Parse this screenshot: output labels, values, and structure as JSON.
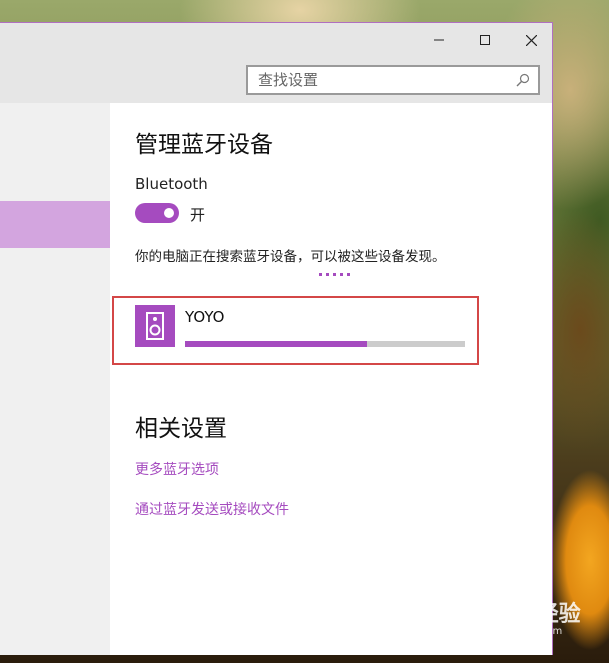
{
  "window": {
    "controls": {
      "minimize": "minimize-icon",
      "maximize": "maximize-icon",
      "close": "close-icon"
    }
  },
  "search": {
    "placeholder": "查找设置",
    "icon": "search-icon"
  },
  "main": {
    "title": "管理蓝牙设备",
    "bluetooth_label": "Bluetooth",
    "toggle_state": "开",
    "toggle_on": true,
    "discovery_text": "你的电脑正在搜索蓝牙设备，可以被这些设备发现。",
    "device": {
      "name": "YOYO",
      "icon": "speaker-icon",
      "progress": 0.65
    }
  },
  "related": {
    "title": "相关设置",
    "links": [
      "更多蓝牙选项",
      "通过蓝牙发送或接收文件"
    ]
  },
  "watermark": {
    "text": "Baidu经验",
    "url": "jingyan.baidu.com"
  },
  "colors": {
    "accent": "#a54bbf",
    "highlight_frame": "#d44747",
    "sidebar_selected": "#d3a5df"
  }
}
